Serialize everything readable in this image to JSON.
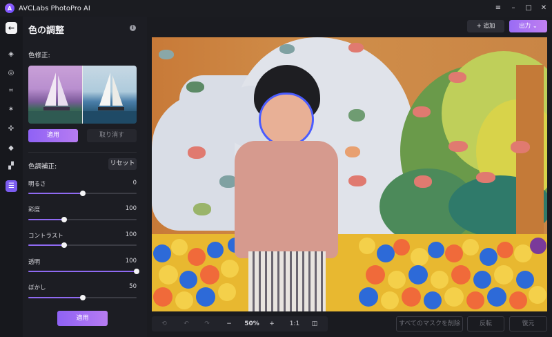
{
  "window": {
    "title": "AVCLabs PhotoPro AI",
    "controls": [
      "menu-icon",
      "minimize-icon",
      "maximize-icon",
      "close-icon"
    ]
  },
  "rail": {
    "tools": [
      "eraser-icon",
      "enhance-icon",
      "crop-icon",
      "sparkle-icon",
      "object-icon",
      "fill-icon",
      "layers-icon",
      "adjust-icon"
    ],
    "active": "adjust-icon"
  },
  "panel": {
    "title": "色の調整",
    "color_correction_label": "色修正:",
    "apply_label": "適用",
    "cancel_label": "取り消す",
    "tone_label": "色調補正:",
    "reset_label": "リセット",
    "sliders": [
      {
        "label": "明るさ",
        "value": "0",
        "fraction": 0.5
      },
      {
        "label": "彩度",
        "value": "100",
        "fraction": 0.33
      },
      {
        "label": "コントラスト",
        "value": "100",
        "fraction": 0.33
      },
      {
        "label": "透明",
        "value": "100",
        "fraction": 1.0
      },
      {
        "label": "ぼかし",
        "value": "50",
        "fraction": 0.5
      }
    ],
    "bottom_apply_label": "適用"
  },
  "header": {
    "add_label": "+ 追加",
    "export_label": "出力"
  },
  "bottombar": {
    "zoom": "50%",
    "one_to_one": "1:1",
    "clear_masks_label": "すべてのマスクを削除",
    "invert_label": "反転",
    "restore_label": "復元"
  },
  "colors": {
    "accent": "#8f62f5",
    "panel_bg": "#1c1d23",
    "app_bg": "#16171c"
  }
}
